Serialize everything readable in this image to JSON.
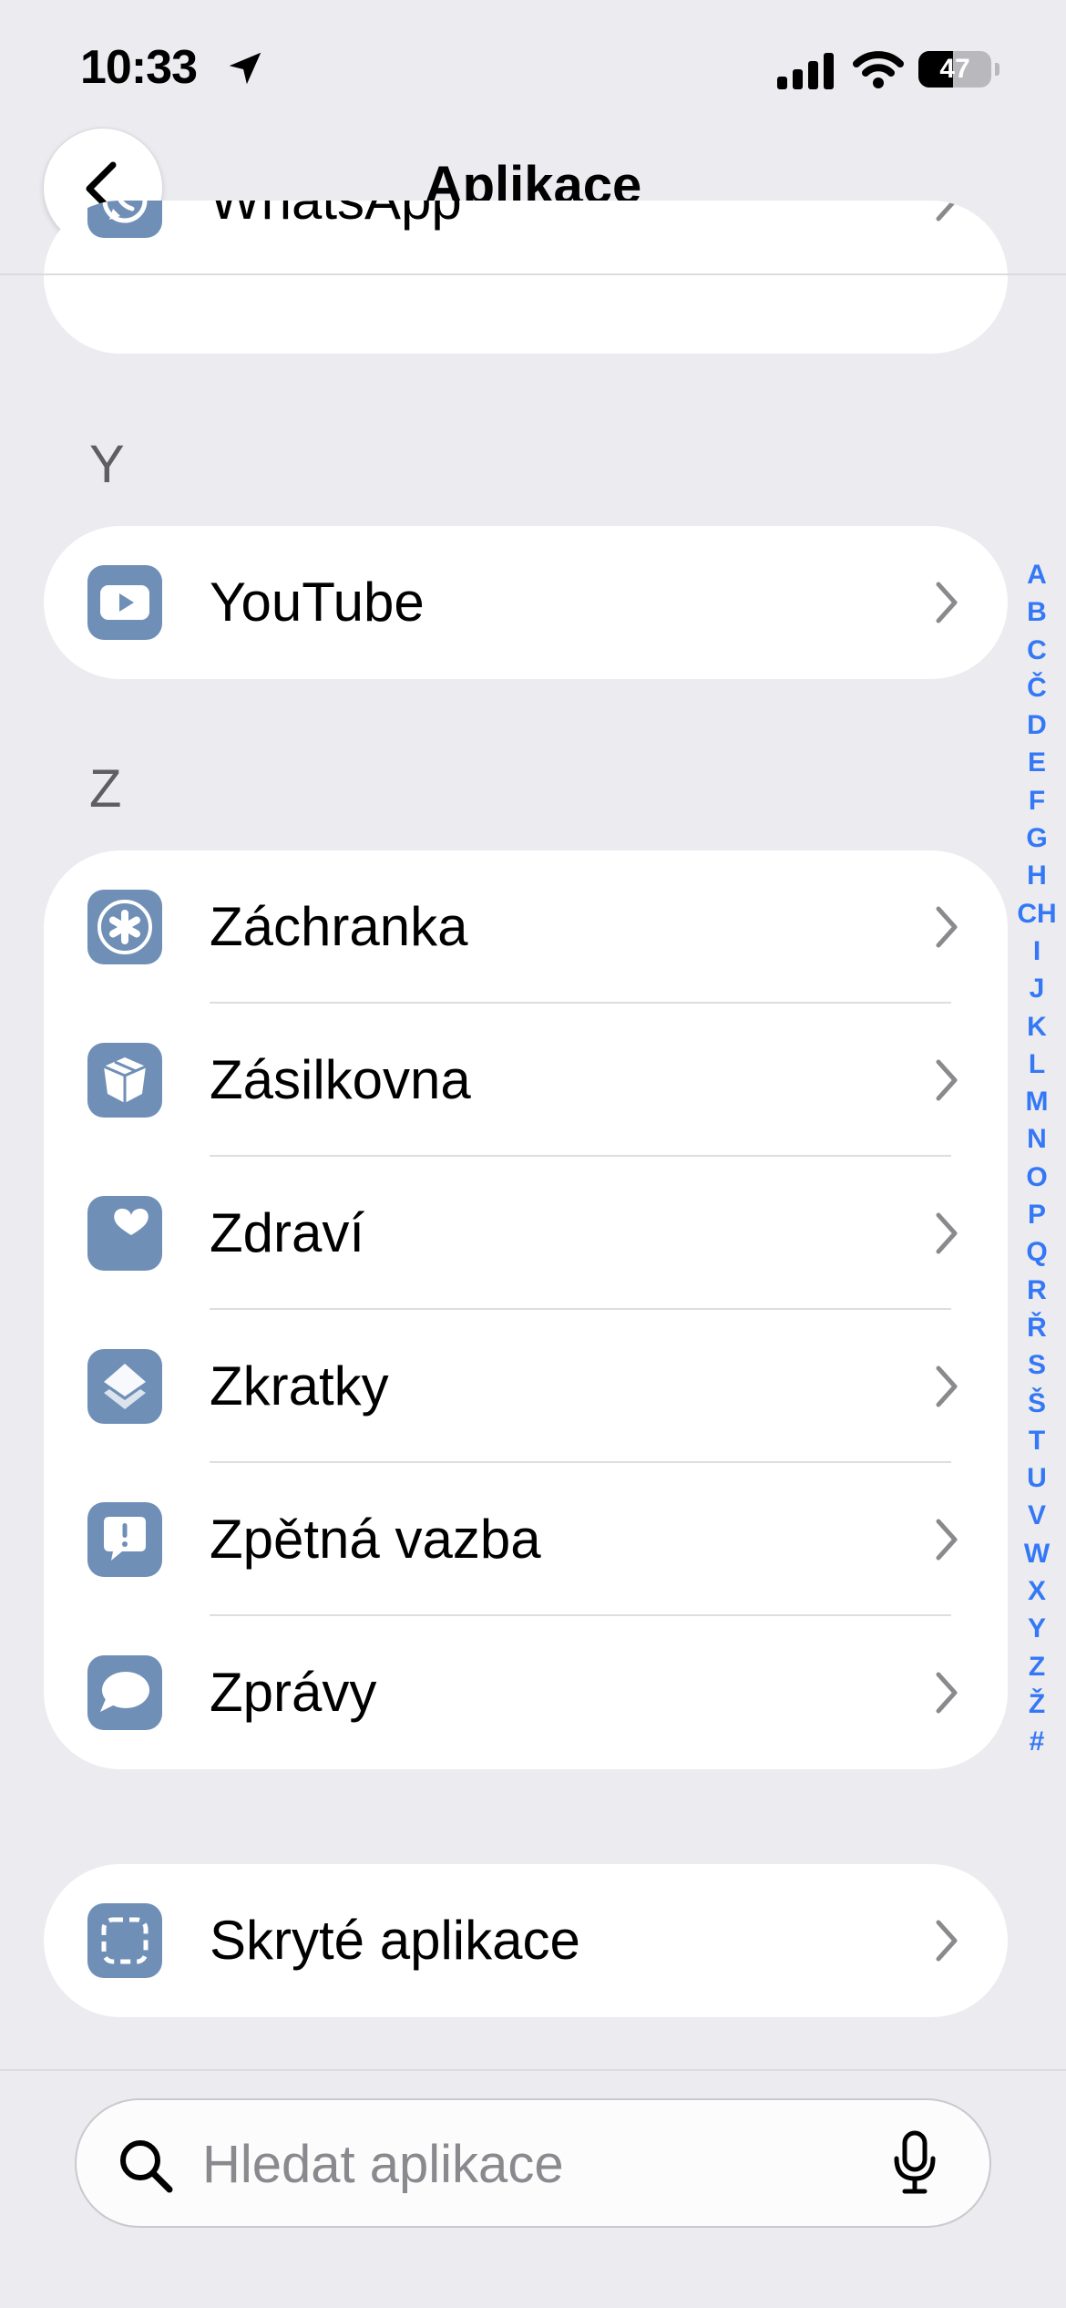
{
  "status_bar": {
    "time": "10:33",
    "battery": "47",
    "battery_level": 0.47
  },
  "nav": {
    "title": "Aplikace",
    "back_icon": "chevron-left-icon"
  },
  "groups": [
    {
      "items": [
        {
          "label": "WhatsApp",
          "icon": "whatsapp-icon"
        }
      ]
    },
    {
      "header": "Y",
      "items": [
        {
          "label": "YouTube",
          "icon": "youtube-icon"
        }
      ]
    },
    {
      "header": "Z",
      "items": [
        {
          "label": "Záchranka",
          "icon": "rescue-icon"
        },
        {
          "label": "Zásilkovna",
          "icon": "package-icon"
        },
        {
          "label": "Zdraví",
          "icon": "health-heart-icon"
        },
        {
          "label": "Zkratky",
          "icon": "shortcuts-icon"
        },
        {
          "label": "Zpětná vazba",
          "icon": "feedback-icon"
        },
        {
          "label": "Zprávy",
          "icon": "messages-icon"
        }
      ]
    },
    {
      "items": [
        {
          "label": "Skryté aplikace",
          "icon": "hidden-apps-icon"
        }
      ]
    }
  ],
  "index": [
    "A",
    "B",
    "C",
    "Č",
    "D",
    "E",
    "F",
    "G",
    "H",
    "CH",
    "I",
    "J",
    "K",
    "L",
    "M",
    "N",
    "O",
    "P",
    "Q",
    "R",
    "Ř",
    "S",
    "Š",
    "T",
    "U",
    "V",
    "W",
    "X",
    "Y",
    "Z",
    "Ž",
    "#"
  ],
  "search": {
    "placeholder": "Hledat aplikace",
    "value": ""
  },
  "colors": {
    "background": "#ebebf0",
    "icon_tint": "#6f8fb7",
    "index_accent": "#3478f6"
  }
}
